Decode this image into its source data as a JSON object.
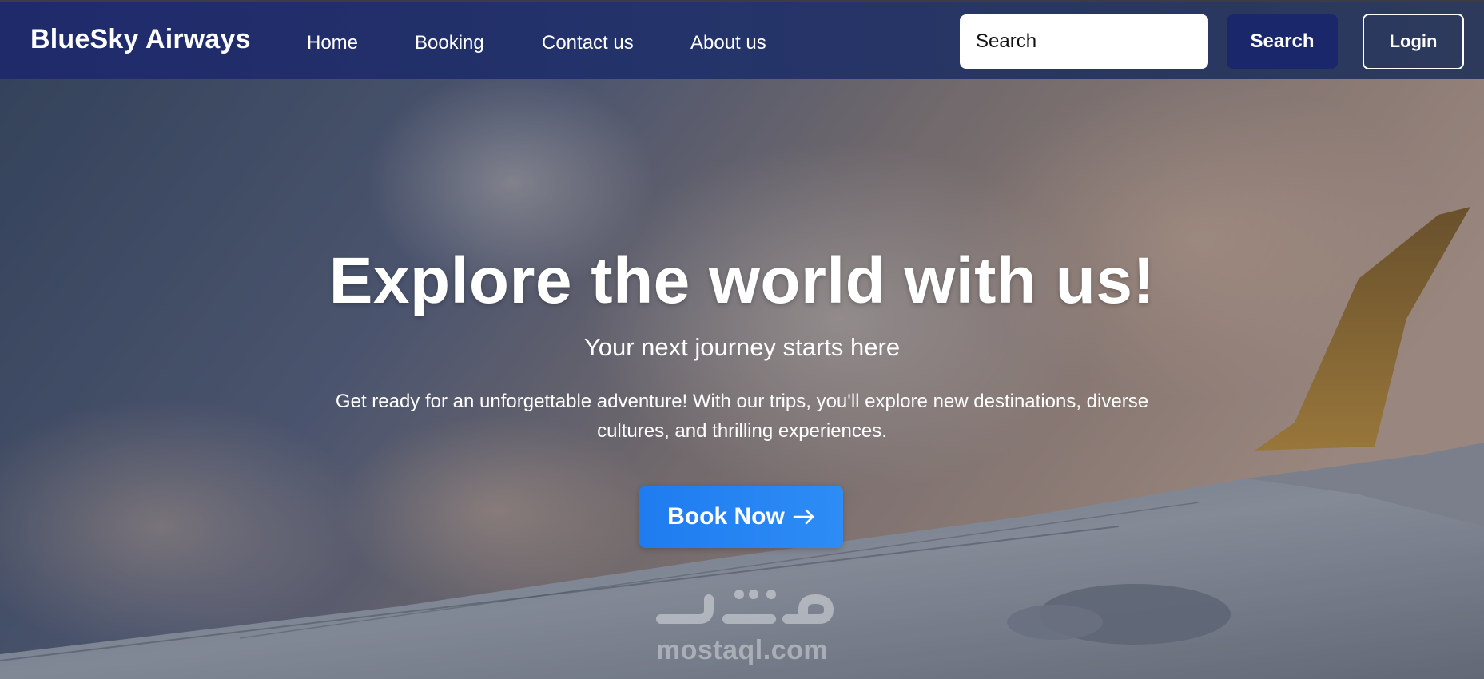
{
  "brand": {
    "name": "BlueSky Airways"
  },
  "nav": {
    "links": [
      {
        "label": "Home"
      },
      {
        "label": "Booking"
      },
      {
        "label": "Contact us"
      },
      {
        "label": "About us"
      }
    ]
  },
  "search": {
    "placeholder": "Search",
    "button_label": "Search"
  },
  "auth": {
    "login_label": "Login"
  },
  "hero": {
    "title": "Explore the world with us!",
    "subtitle": "Your next journey starts here",
    "description": "Get ready for an unforgettable adventure! With our trips, you'll explore new destinations, diverse cultures, and thrilling experiences.",
    "cta_label": "Book Now",
    "cta_icon": "arrow-right-icon"
  },
  "watermark": {
    "logo": "mostaql-logo",
    "text": "mostaql.com"
  },
  "colors": {
    "navbar": "#1f2a6b",
    "search_button": "#1b276b",
    "cta": "#1f7cf0"
  }
}
